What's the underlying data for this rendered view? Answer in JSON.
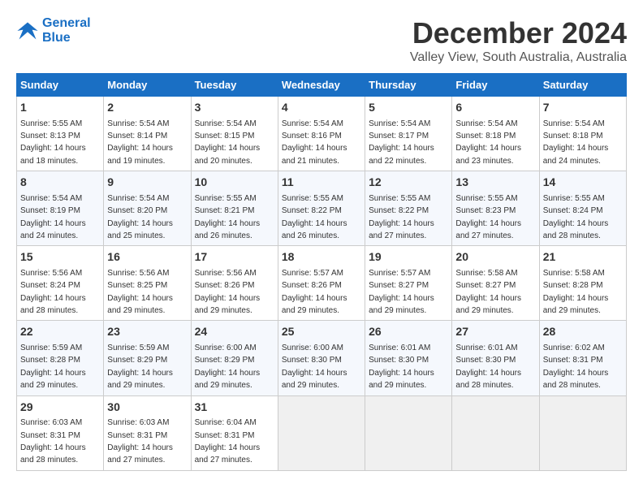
{
  "logo": {
    "line1": "General",
    "line2": "Blue"
  },
  "title": "December 2024",
  "location": "Valley View, South Australia, Australia",
  "days_of_week": [
    "Sunday",
    "Monday",
    "Tuesday",
    "Wednesday",
    "Thursday",
    "Friday",
    "Saturday"
  ],
  "weeks": [
    [
      {
        "day": 1,
        "sunrise": "5:55 AM",
        "sunset": "8:13 PM",
        "daylight": "14 hours and 18 minutes."
      },
      {
        "day": 2,
        "sunrise": "5:54 AM",
        "sunset": "8:14 PM",
        "daylight": "14 hours and 19 minutes."
      },
      {
        "day": 3,
        "sunrise": "5:54 AM",
        "sunset": "8:15 PM",
        "daylight": "14 hours and 20 minutes."
      },
      {
        "day": 4,
        "sunrise": "5:54 AM",
        "sunset": "8:16 PM",
        "daylight": "14 hours and 21 minutes."
      },
      {
        "day": 5,
        "sunrise": "5:54 AM",
        "sunset": "8:17 PM",
        "daylight": "14 hours and 22 minutes."
      },
      {
        "day": 6,
        "sunrise": "5:54 AM",
        "sunset": "8:18 PM",
        "daylight": "14 hours and 23 minutes."
      },
      {
        "day": 7,
        "sunrise": "5:54 AM",
        "sunset": "8:18 PM",
        "daylight": "14 hours and 24 minutes."
      }
    ],
    [
      {
        "day": 8,
        "sunrise": "5:54 AM",
        "sunset": "8:19 PM",
        "daylight": "14 hours and 24 minutes."
      },
      {
        "day": 9,
        "sunrise": "5:54 AM",
        "sunset": "8:20 PM",
        "daylight": "14 hours and 25 minutes."
      },
      {
        "day": 10,
        "sunrise": "5:55 AM",
        "sunset": "8:21 PM",
        "daylight": "14 hours and 26 minutes."
      },
      {
        "day": 11,
        "sunrise": "5:55 AM",
        "sunset": "8:22 PM",
        "daylight": "14 hours and 26 minutes."
      },
      {
        "day": 12,
        "sunrise": "5:55 AM",
        "sunset": "8:22 PM",
        "daylight": "14 hours and 27 minutes."
      },
      {
        "day": 13,
        "sunrise": "5:55 AM",
        "sunset": "8:23 PM",
        "daylight": "14 hours and 27 minutes."
      },
      {
        "day": 14,
        "sunrise": "5:55 AM",
        "sunset": "8:24 PM",
        "daylight": "14 hours and 28 minutes."
      }
    ],
    [
      {
        "day": 15,
        "sunrise": "5:56 AM",
        "sunset": "8:24 PM",
        "daylight": "14 hours and 28 minutes."
      },
      {
        "day": 16,
        "sunrise": "5:56 AM",
        "sunset": "8:25 PM",
        "daylight": "14 hours and 29 minutes."
      },
      {
        "day": 17,
        "sunrise": "5:56 AM",
        "sunset": "8:26 PM",
        "daylight": "14 hours and 29 minutes."
      },
      {
        "day": 18,
        "sunrise": "5:57 AM",
        "sunset": "8:26 PM",
        "daylight": "14 hours and 29 minutes."
      },
      {
        "day": 19,
        "sunrise": "5:57 AM",
        "sunset": "8:27 PM",
        "daylight": "14 hours and 29 minutes."
      },
      {
        "day": 20,
        "sunrise": "5:58 AM",
        "sunset": "8:27 PM",
        "daylight": "14 hours and 29 minutes."
      },
      {
        "day": 21,
        "sunrise": "5:58 AM",
        "sunset": "8:28 PM",
        "daylight": "14 hours and 29 minutes."
      }
    ],
    [
      {
        "day": 22,
        "sunrise": "5:59 AM",
        "sunset": "8:28 PM",
        "daylight": "14 hours and 29 minutes."
      },
      {
        "day": 23,
        "sunrise": "5:59 AM",
        "sunset": "8:29 PM",
        "daylight": "14 hours and 29 minutes."
      },
      {
        "day": 24,
        "sunrise": "6:00 AM",
        "sunset": "8:29 PM",
        "daylight": "14 hours and 29 minutes."
      },
      {
        "day": 25,
        "sunrise": "6:00 AM",
        "sunset": "8:30 PM",
        "daylight": "14 hours and 29 minutes."
      },
      {
        "day": 26,
        "sunrise": "6:01 AM",
        "sunset": "8:30 PM",
        "daylight": "14 hours and 29 minutes."
      },
      {
        "day": 27,
        "sunrise": "6:01 AM",
        "sunset": "8:30 PM",
        "daylight": "14 hours and 28 minutes."
      },
      {
        "day": 28,
        "sunrise": "6:02 AM",
        "sunset": "8:31 PM",
        "daylight": "14 hours and 28 minutes."
      }
    ],
    [
      {
        "day": 29,
        "sunrise": "6:03 AM",
        "sunset": "8:31 PM",
        "daylight": "14 hours and 28 minutes."
      },
      {
        "day": 30,
        "sunrise": "6:03 AM",
        "sunset": "8:31 PM",
        "daylight": "14 hours and 27 minutes."
      },
      {
        "day": 31,
        "sunrise": "6:04 AM",
        "sunset": "8:31 PM",
        "daylight": "14 hours and 27 minutes."
      },
      null,
      null,
      null,
      null
    ]
  ]
}
